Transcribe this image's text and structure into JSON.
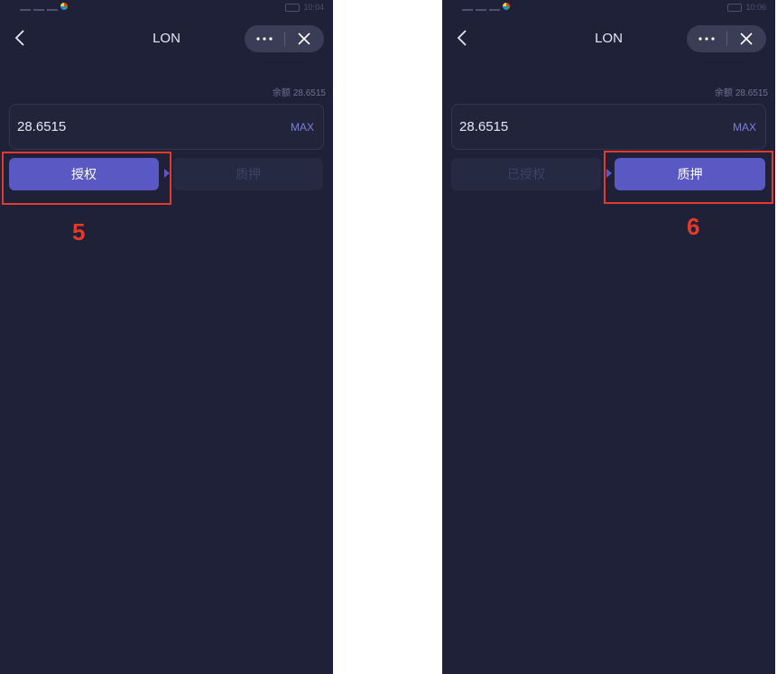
{
  "colors": {
    "background": "#1f2139",
    "button_active": "#5a58c3",
    "button_inactive": "#262942",
    "highlight": "#e53a2a",
    "max_text": "#7b7fd6"
  },
  "left": {
    "status_time": "10:04",
    "nav_title": "LON",
    "back_icon": "chevron-left-icon",
    "more_icon": "more-dots-icon",
    "close_icon": "close-icon",
    "balance_label": "余额",
    "balance_value": "28.6515",
    "amount": "28.6515",
    "max_label": "MAX",
    "button_1_label": "授权",
    "button_2_label": "质押",
    "step_number": "5"
  },
  "right": {
    "status_time": "10:06",
    "nav_title": "LON",
    "back_icon": "chevron-left-icon",
    "more_icon": "more-dots-icon",
    "close_icon": "close-icon",
    "balance_label": "余额",
    "balance_value": "28.6515",
    "amount": "28.6515",
    "max_label": "MAX",
    "button_1_label": "已授权",
    "button_2_label": "质押",
    "step_number": "6"
  }
}
